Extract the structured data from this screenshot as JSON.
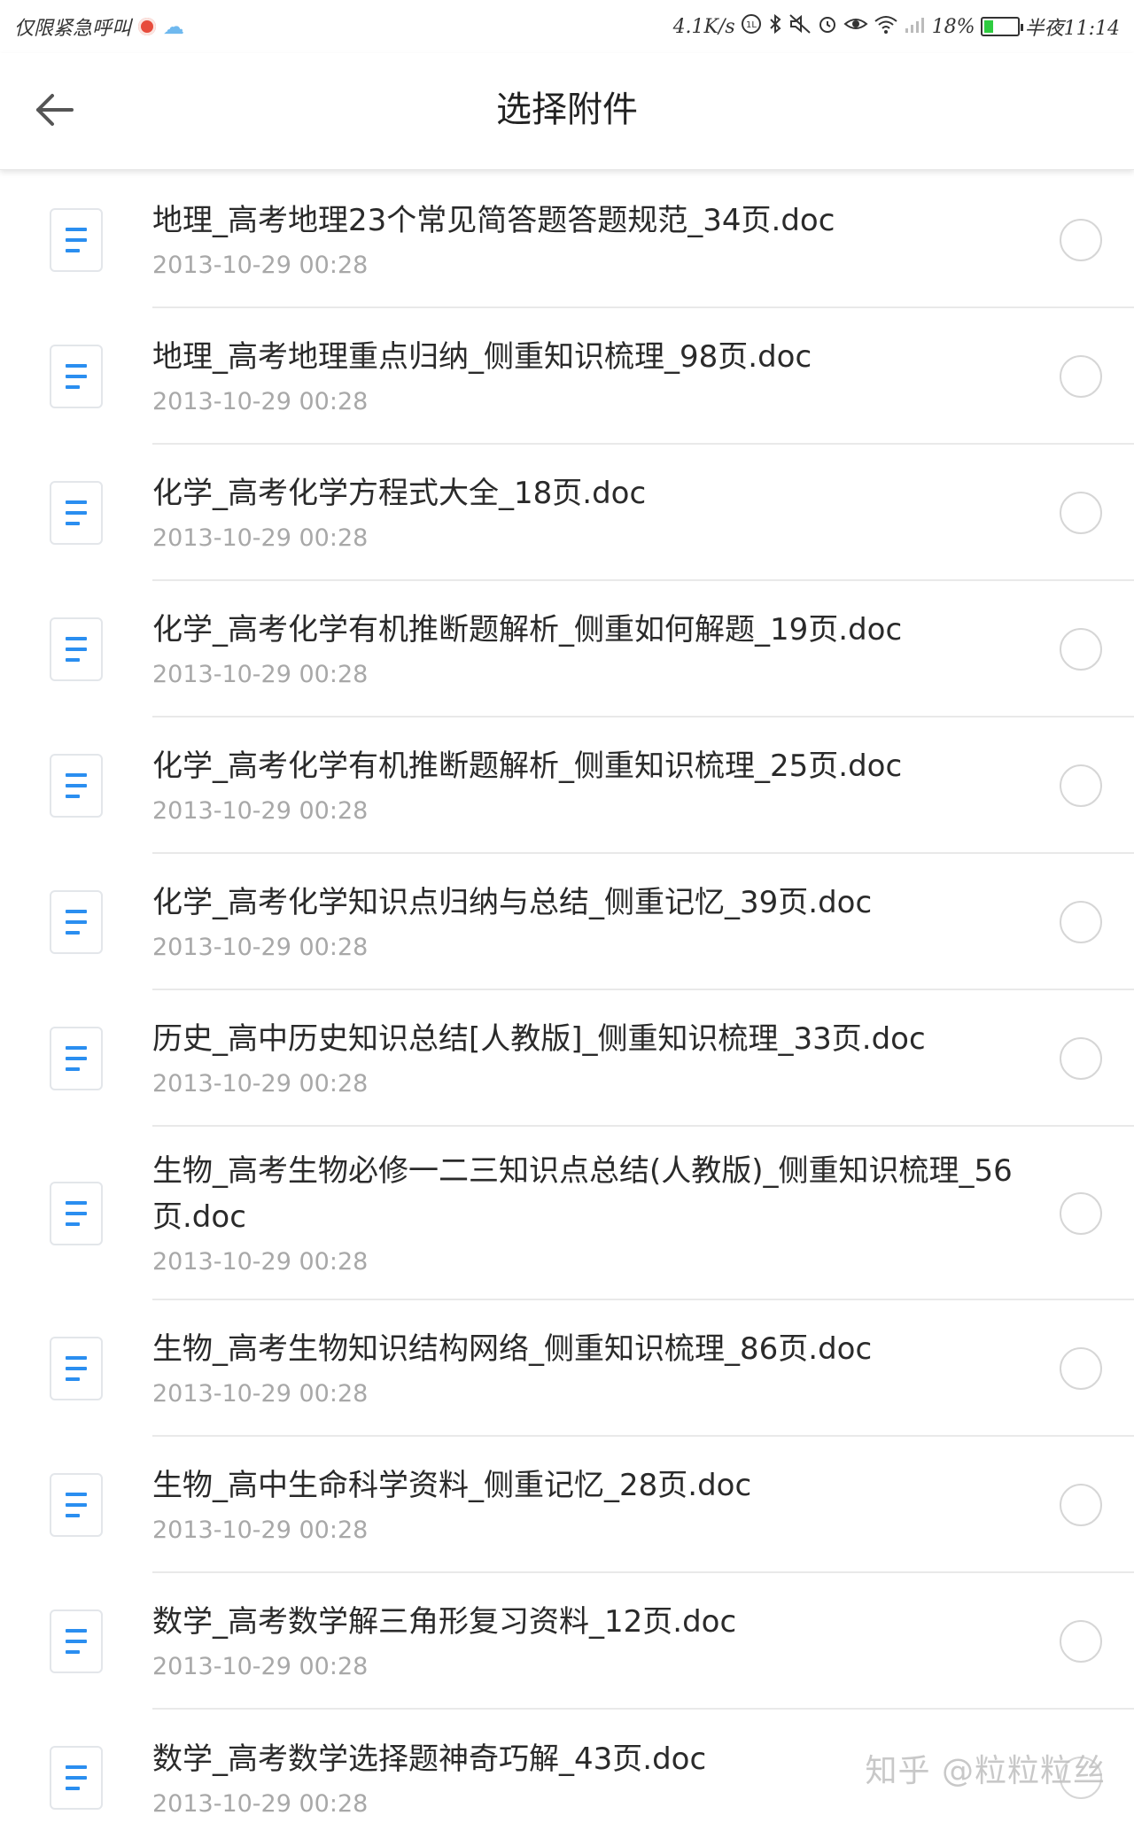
{
  "status_bar": {
    "left_text": "仅限紧急呼叫",
    "network_speed": "4.1K/s",
    "signal_badge": "1L",
    "battery_percent": "18%",
    "time": "半夜11:14",
    "icons": [
      "notification-app-icon",
      "weather-icon",
      "hd-icon",
      "bluetooth-icon",
      "mute-icon",
      "alarm-icon",
      "eye-icon",
      "wifi-icon",
      "cell-signal-icon",
      "battery-icon"
    ]
  },
  "toolbar": {
    "title": "选择附件",
    "back_icon": "arrow-left-icon"
  },
  "files": [
    {
      "name": "地理_高考地理23个常见简答题答题规范_34页.doc",
      "date": "2013-10-29 00:28"
    },
    {
      "name": "地理_高考地理重点归纳_侧重知识梳理_98页.doc",
      "date": "2013-10-29 00:28"
    },
    {
      "name": "化学_高考化学方程式大全_18页.doc",
      "date": "2013-10-29 00:28"
    },
    {
      "name": "化学_高考化学有机推断题解析_侧重如何解题_19页.doc",
      "date": "2013-10-29 00:28"
    },
    {
      "name": "化学_高考化学有机推断题解析_侧重知识梳理_25页.doc",
      "date": "2013-10-29 00:28"
    },
    {
      "name": "化学_高考化学知识点归纳与总结_侧重记忆_39页.doc",
      "date": "2013-10-29 00:28"
    },
    {
      "name": "历史_高中历史知识总结[人教版]_侧重知识梳理_33页.doc",
      "date": "2013-10-29 00:28"
    },
    {
      "name": "生物_高考生物必修一二三知识点总结(人教版)_侧重知识梳理_56页.doc",
      "date": "2013-10-29 00:28"
    },
    {
      "name": "生物_高考生物知识结构网络_侧重知识梳理_86页.doc",
      "date": "2013-10-29 00:28"
    },
    {
      "name": "生物_高中生命科学资料_侧重记忆_28页.doc",
      "date": "2013-10-29 00:28"
    },
    {
      "name": "数学_高考数学解三角形复习资料_12页.doc",
      "date": "2013-10-29 00:28"
    },
    {
      "name": "数学_高考数学选择题神奇巧解_43页.doc",
      "date": "2013-10-29 00:28"
    }
  ],
  "watermark": "知乎 @粒粒粒丝",
  "colors": {
    "doc_icon_lines": "#2a8ef0",
    "divider": "#e9e9e9",
    "date_text": "#a8a8a8"
  }
}
